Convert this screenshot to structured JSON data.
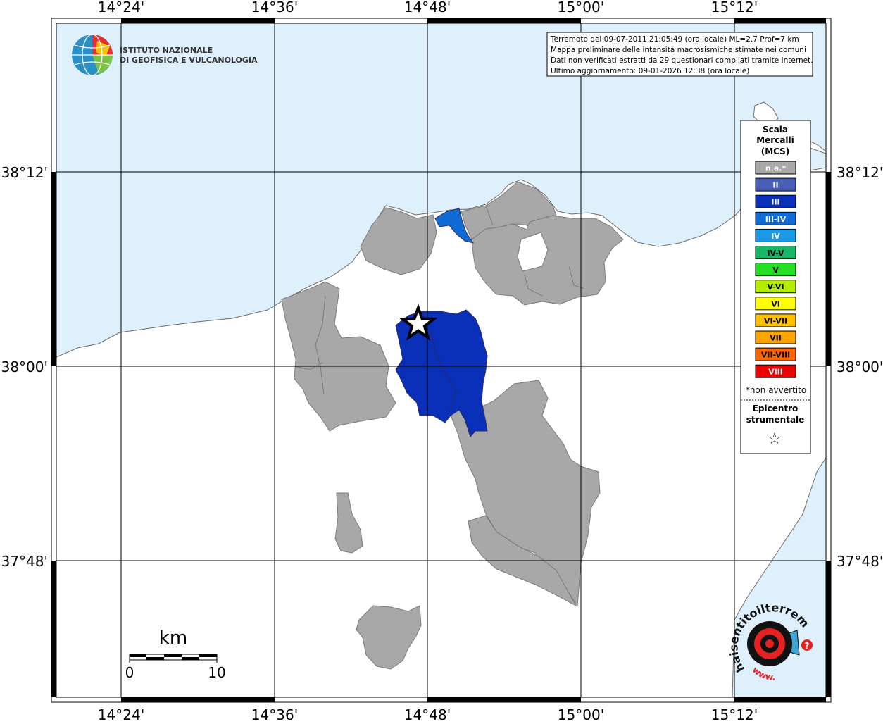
{
  "map": {
    "lon_labels": [
      "14°24'",
      "14°36'",
      "14°48'",
      "15°00'",
      "15°12'"
    ],
    "lat_labels": [
      "38°12'",
      "38°00'",
      "37°48'"
    ],
    "colors": {
      "sea": "#dff0fd",
      "land": "#ffffff",
      "not_felt": "#a8a8a8",
      "epicenter_area": "#0a2fb8",
      "coastal_area": "#0e6ad4"
    }
  },
  "info_box": {
    "line1": "Terremoto del 09-07-2011 21:05:49 (ora locale) ML=2.7 Prof=7 km",
    "line2": "Mappa preliminare delle intensità macrosismiche stimate nei comuni",
    "line3": "Dati non verificati estratti da 29 questionari compilati tramite Internet.",
    "line4": "Ultimo aggiornamento: 09-01-2026 12:38 (ora locale)"
  },
  "logo_ingv": {
    "line1": "ISTITUTO NAZIONALE",
    "line2": "DI GEOFISICA E VULCANOLOGIA"
  },
  "legend": {
    "title1": "Scala",
    "title2": "Mercalli",
    "title3": "(MCS)",
    "items": [
      {
        "label": "n.a.*",
        "color": "#a8a8a8"
      },
      {
        "label": "II",
        "color": "#4a5fb8"
      },
      {
        "label": "III",
        "color": "#0a2fb8"
      },
      {
        "label": "III-IV",
        "color": "#0e6ad4"
      },
      {
        "label": "IV",
        "color": "#1a9be6"
      },
      {
        "label": "IV-V",
        "color": "#17b86a"
      },
      {
        "label": "V",
        "color": "#22e022"
      },
      {
        "label": "V-VI",
        "color": "#b5ec00"
      },
      {
        "label": "VI",
        "color": "#ffff00"
      },
      {
        "label": "VI-VII",
        "color": "#ffc000"
      },
      {
        "label": "VII",
        "color": "#ffa500"
      },
      {
        "label": "VII-VIII",
        "color": "#ff6600"
      },
      {
        "label": "VIII",
        "color": "#ee0000"
      }
    ],
    "footnote": "*non avvertito",
    "epicenter1": "Epicentro",
    "epicenter2": "strumentale",
    "epicenter_symbol": "☆"
  },
  "scale_bar": {
    "unit": "km",
    "min_label": "0",
    "max_label": "10"
  },
  "haisentito_logo": {
    "text_outer": "haisentitoilterremoto.it",
    "text_inner": "www.",
    "question": "?"
  }
}
